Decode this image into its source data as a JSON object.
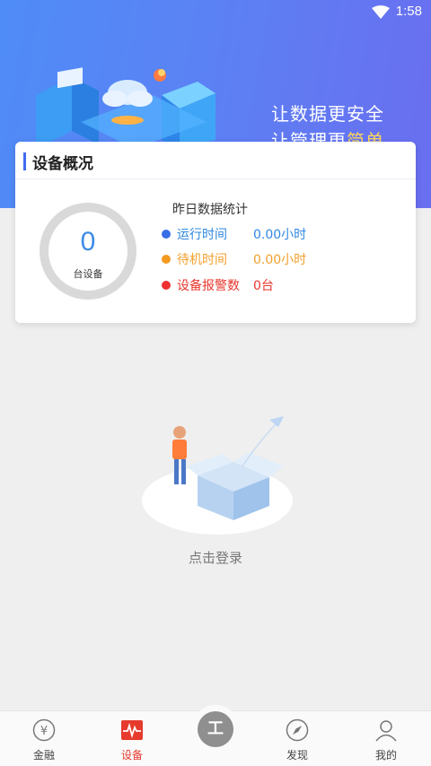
{
  "status_bar": {
    "time": "1:58",
    "wifi_icon": "wifi-icon"
  },
  "banner": {
    "slogan_line1": "让数据更安全",
    "slogan_line2_prefix": "让管理更",
    "slogan_line2_highlight": "简单"
  },
  "overview": {
    "title": "设备概况",
    "device_count": "0",
    "device_count_label": "台设备",
    "stats_title": "昨日数据统计",
    "stats": [
      {
        "label": "运行时间",
        "value": "0.00小时",
        "color": "#3a6ee6"
      },
      {
        "label": "待机时间",
        "value": "0.00小时",
        "color": "#f49a20"
      },
      {
        "label": "设备报警数",
        "value": "0台",
        "color": "#ee3030"
      }
    ]
  },
  "empty_state": {
    "login_text": "点击登录"
  },
  "tabbar": {
    "items": [
      {
        "label": "金融",
        "icon": "yen-icon"
      },
      {
        "label": "设备",
        "icon": "device-pulse-icon",
        "active": true
      },
      {
        "label": "工",
        "icon": "center-tool-icon"
      },
      {
        "label": "发现",
        "icon": "compass-icon"
      },
      {
        "label": "我的",
        "icon": "user-icon"
      }
    ]
  }
}
